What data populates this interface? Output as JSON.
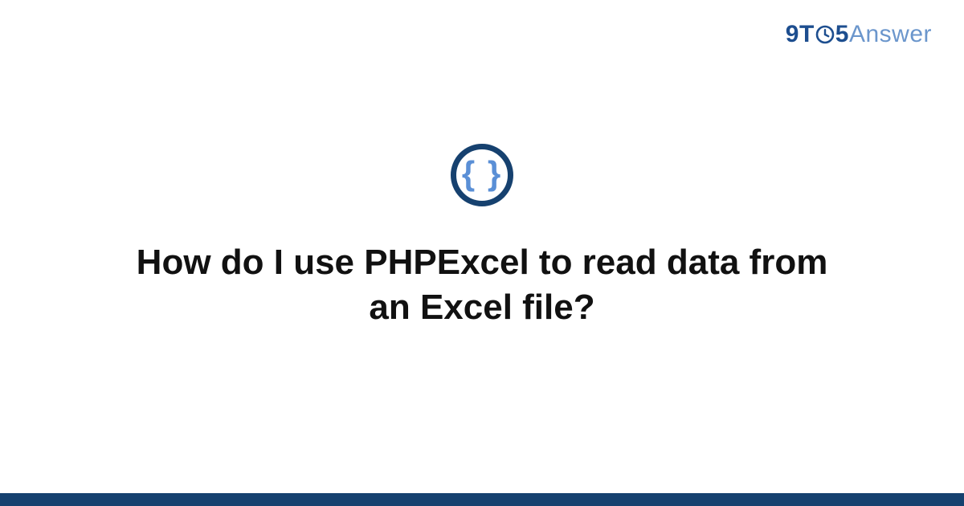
{
  "brand": {
    "part1": "9",
    "part2": "T",
    "part3": "5",
    "part4": "Answer"
  },
  "icon": {
    "braces": "{ }"
  },
  "question": {
    "title": "How do I use PHPExcel to read data from an Excel file?"
  },
  "colors": {
    "brand_dark": "#16416f",
    "brand_mid": "#1d4e8f",
    "brand_light": "#6b96cc",
    "icon_braces": "#5a8fd6"
  }
}
